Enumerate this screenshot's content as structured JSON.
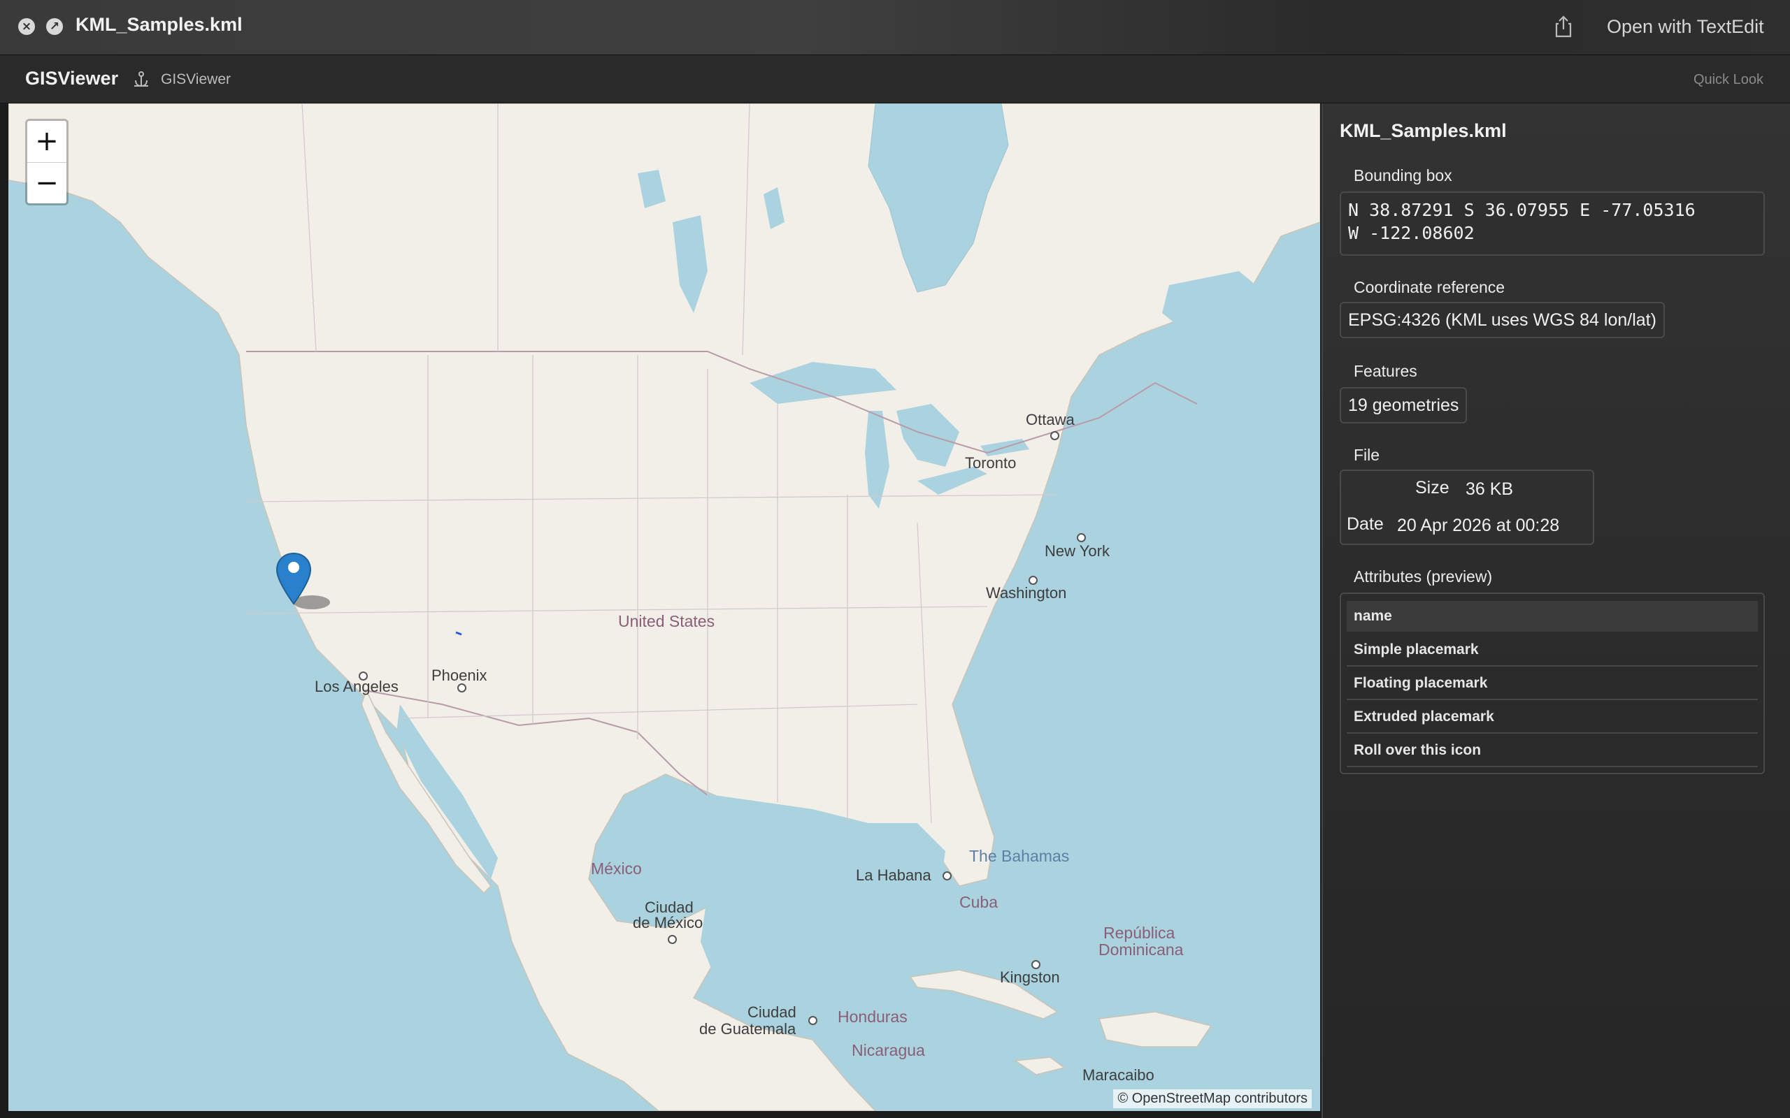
{
  "window": {
    "title": "KML_Samples.kml",
    "open_with": "Open with TextEdit"
  },
  "appbar": {
    "app_name": "GISViewer",
    "app_sub": "GISViewer",
    "quick_look": "Quick Look"
  },
  "map": {
    "zoom_in": "+",
    "zoom_out": "−",
    "attribution": "© OpenStreetMap contributors",
    "labels": {
      "ottawa": "Ottawa",
      "toronto": "Toronto",
      "new_york": "New York",
      "washington": "Washington",
      "united_states": "United States",
      "phoenix": "Phoenix",
      "los_angeles": "Los Angeles",
      "mexico": "México",
      "mexico_city_1": "Ciudad",
      "mexico_city_2": "de México",
      "la_habana": "La Habana",
      "bahamas": "The Bahamas",
      "cuba": "Cuba",
      "dominicana_1": "República",
      "dominicana_2": "Dominicana",
      "kingston": "Kingston",
      "guatemala_1": "Ciudad",
      "guatemala_2": "de Guatemala",
      "honduras": "Honduras",
      "nicaragua": "Nicaragua",
      "maracaibo": "Maracaibo"
    }
  },
  "panel": {
    "file_name": "KML_Samples.kml",
    "bbox_label": "Bounding box",
    "bbox_line1": "N 38.87291  S 36.07955  E -77.05316",
    "bbox_line2": "W -122.08602",
    "crs_label": "Coordinate reference",
    "crs_value": "EPSG:4326 (KML uses WGS 84 lon/lat)",
    "features_label": "Features",
    "features_value": "19 geometries",
    "file_label": "File",
    "size_key": "Size",
    "size_value": "36 KB",
    "date_key": "Date",
    "date_value": "20 Apr 2026 at 00:28",
    "attributes_label": "Attributes (preview)",
    "attr_header": "name",
    "attr_rows": [
      "Simple placemark",
      "Floating placemark",
      "Extruded placemark",
      "Roll over this icon"
    ]
  },
  "colors": {
    "water": "#aad3df",
    "land": "#f2efe9",
    "marker": "#2a81cb"
  }
}
